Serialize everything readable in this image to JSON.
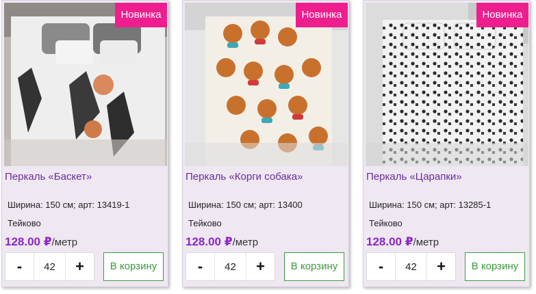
{
  "colors": {
    "badge_bg": "#ef1e8f",
    "title": "#6b2a9a",
    "price": "#8a27c4",
    "cart_border": "#3b9b3b",
    "card_bg": "#efe8f3"
  },
  "products": [
    {
      "badge": "Новинка",
      "image_icon": "basketball-bedding-photo",
      "title": "Перкаль «Баскет»",
      "specs": "Ширина: 150 см; арт: 13419-1",
      "city": "Тейково",
      "price": "128.00 ₽",
      "unit": "/метр",
      "qty_minus": "-",
      "qty_value": "42",
      "qty_plus": "+",
      "cart_label": "В корзину"
    },
    {
      "badge": "Новинка",
      "image_icon": "corgi-bedding-photo",
      "title": "Перкаль «Корги собака»",
      "specs": "Ширина: 150 см; арт: 13400",
      "city": "Тейково",
      "price": "128.00 ₽",
      "unit": "/метр",
      "qty_minus": "-",
      "qty_value": "42",
      "qty_plus": "+",
      "cart_label": "В корзину"
    },
    {
      "badge": "Новинка",
      "image_icon": "cat-pattern-bedding-photo",
      "title": "Перкаль «Царапки»",
      "specs": "Ширина: 150 см; арт: 13285-1",
      "city": "Тейково",
      "price": "128.00 ₽",
      "unit": "/метр",
      "qty_minus": "-",
      "qty_value": "42",
      "qty_plus": "+",
      "cart_label": "В корзину"
    }
  ]
}
